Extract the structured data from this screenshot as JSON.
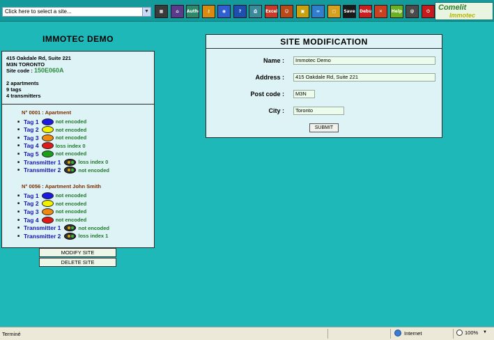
{
  "toolbar": {
    "site_select": {
      "value": "Click here to select a site..."
    },
    "tools": [
      {
        "name": "building-icon",
        "glyph": "▦",
        "bg": "#3a3a3a"
      },
      {
        "name": "home-icon",
        "glyph": "⌂",
        "bg": "#5a3a8a"
      },
      {
        "name": "autho-icon",
        "glyph": "Autho",
        "bg": "#2c8a6a"
      },
      {
        "name": "key-icon",
        "glyph": "⚷",
        "bg": "#d98a10"
      },
      {
        "name": "cd-icon",
        "glyph": "◉",
        "bg": "#2f5fd0"
      },
      {
        "name": "help-question-icon",
        "glyph": "?",
        "bg": "#1c4fb0"
      },
      {
        "name": "print-icon",
        "glyph": "⎙",
        "bg": "#3a8a9a"
      },
      {
        "name": "excel-icon",
        "glyph": "Excel",
        "bg": "#c83a2a"
      },
      {
        "name": "users-icon",
        "glyph": "☺",
        "bg": "#b84a1a"
      },
      {
        "name": "device-icon",
        "glyph": "▣",
        "bg": "#c8a010"
      },
      {
        "name": "link-icon",
        "glyph": "∞",
        "bg": "#2f7fd0"
      },
      {
        "name": "frame-icon",
        "glyph": "▢",
        "bg": "#d8a020"
      },
      {
        "name": "save-icon",
        "glyph": "Save",
        "bg": "#1a1a1a"
      },
      {
        "name": "debug-icon",
        "glyph": "Debug",
        "bg": "#c82020"
      },
      {
        "name": "tools-icon",
        "glyph": "✕",
        "bg": "#c84020"
      },
      {
        "name": "help-icon",
        "glyph": "Help",
        "bg": "#6ab020"
      },
      {
        "name": "email-icon",
        "glyph": "@",
        "bg": "#4a4a4a"
      },
      {
        "name": "power-icon",
        "glyph": "⏻",
        "bg": "#c81a1a"
      }
    ],
    "logo_line1": "Comelit",
    "logo_line2": "Immotec"
  },
  "site": {
    "title": "IMMOTEC DEMO",
    "address_line": "415 Oakdale Rd, Suite 221",
    "city_line": "M3N TORONTO",
    "code_label": "Site code : ",
    "code_value": "150E060A",
    "apartments": "2 apartments",
    "tags": "9 tags",
    "transmitters": "4 transmitters"
  },
  "apartments": [
    {
      "heading": "N° 0001 : Apartment",
      "items": [
        {
          "label": "Tag 1",
          "kind": "tag",
          "color": "#1a1ae0",
          "status": "not encoded"
        },
        {
          "label": "Tag 2",
          "kind": "tag",
          "color": "#f2f200",
          "status": "not encoded"
        },
        {
          "label": "Tag 3",
          "kind": "tag",
          "color": "#f08a10",
          "status": "not encoded"
        },
        {
          "label": "Tag 4",
          "kind": "tag",
          "color": "#e01a1a",
          "status": "loss index 0"
        },
        {
          "label": "Tag 5",
          "kind": "tag",
          "color": "#1aa01a",
          "status": "not encoded"
        },
        {
          "label": "Transmitter 1",
          "kind": "remote",
          "status": "loss index 0"
        },
        {
          "label": "Transmitter 2",
          "kind": "remote",
          "status": "not encoded"
        }
      ]
    },
    {
      "heading": "N° 0056 : Apartment John Smith",
      "items": [
        {
          "label": "Tag 1",
          "kind": "tag",
          "color": "#1a1ae0",
          "status": "not encoded"
        },
        {
          "label": "Tag 2",
          "kind": "tag",
          "color": "#f2f200",
          "status": "not encoded"
        },
        {
          "label": "Tag 3",
          "kind": "tag",
          "color": "#f08a10",
          "status": "not encoded"
        },
        {
          "label": "Tag 4",
          "kind": "tag",
          "color": "#e01a1a",
          "status": "not encoded"
        },
        {
          "label": "Transmitter 1",
          "kind": "remote",
          "status": "not encoded"
        },
        {
          "label": "Transmitter 2",
          "kind": "remote",
          "status": "loss index 1"
        }
      ]
    }
  ],
  "actions": {
    "modify": "MODIFY SITE",
    "delete": "DELETE SITE"
  },
  "form": {
    "title": "SITE MODIFICATION",
    "name_label": "Name :",
    "name_value": "Immotec Demo",
    "address_label": "Address :",
    "address_value": "415 Oakdale Rd, Suite 221",
    "postcode_label": "Post code :",
    "postcode_value": "M3N",
    "city_label": "City :",
    "city_value": "Toronto",
    "submit": "SUBMIT"
  },
  "statusbar": {
    "status": "Terminé",
    "zone": "Internet",
    "zoom": "100%"
  },
  "colors": {
    "background": "#1fb8b8",
    "panel": "#def3f5",
    "status_text": "#1f7a2a",
    "item_label": "#1515b0"
  }
}
